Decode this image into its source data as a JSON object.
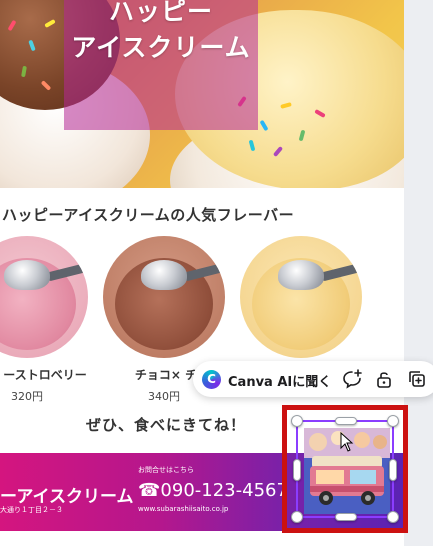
{
  "hero": {
    "title_line1": "ハッピー",
    "title_line2": "アイスクリーム"
  },
  "section": {
    "heading": "ハッピーアイスクリームの人気フレーバー"
  },
  "flavors": [
    {
      "name": "ーストロベリー",
      "price": "320円",
      "icon": "strawberry-ice-cream-photo"
    },
    {
      "name": "チョコ× チョ",
      "price": "340円",
      "icon": "chocolate-ice-cream-photo"
    },
    {
      "name": "",
      "price": "",
      "icon": "vanilla-ice-cream-photo"
    }
  ],
  "cta": {
    "text": "ぜひ、食べにきてね！"
  },
  "footer": {
    "shop_name": "ーアイスクリーム",
    "address": "大通り１丁目２－３",
    "inquiry_label": "お問合せはこちら",
    "phone": "☎090-123-4567",
    "url": "www.subarashiisaito.co.jp"
  },
  "ai_toolbar": {
    "label": "Canva AIに聞く",
    "logo_glyph": "C",
    "icons": [
      "comment-add-icon",
      "lock-icon",
      "duplicate-icon"
    ]
  },
  "selection": {
    "element": "food-truck-illustration",
    "highlight_color": "#cc1111",
    "frame_color": "#8b3dff"
  },
  "colors": {
    "footer_start": "#d4157f",
    "footer_end": "#5a23b4",
    "hero_overlay": "#b4289680"
  }
}
